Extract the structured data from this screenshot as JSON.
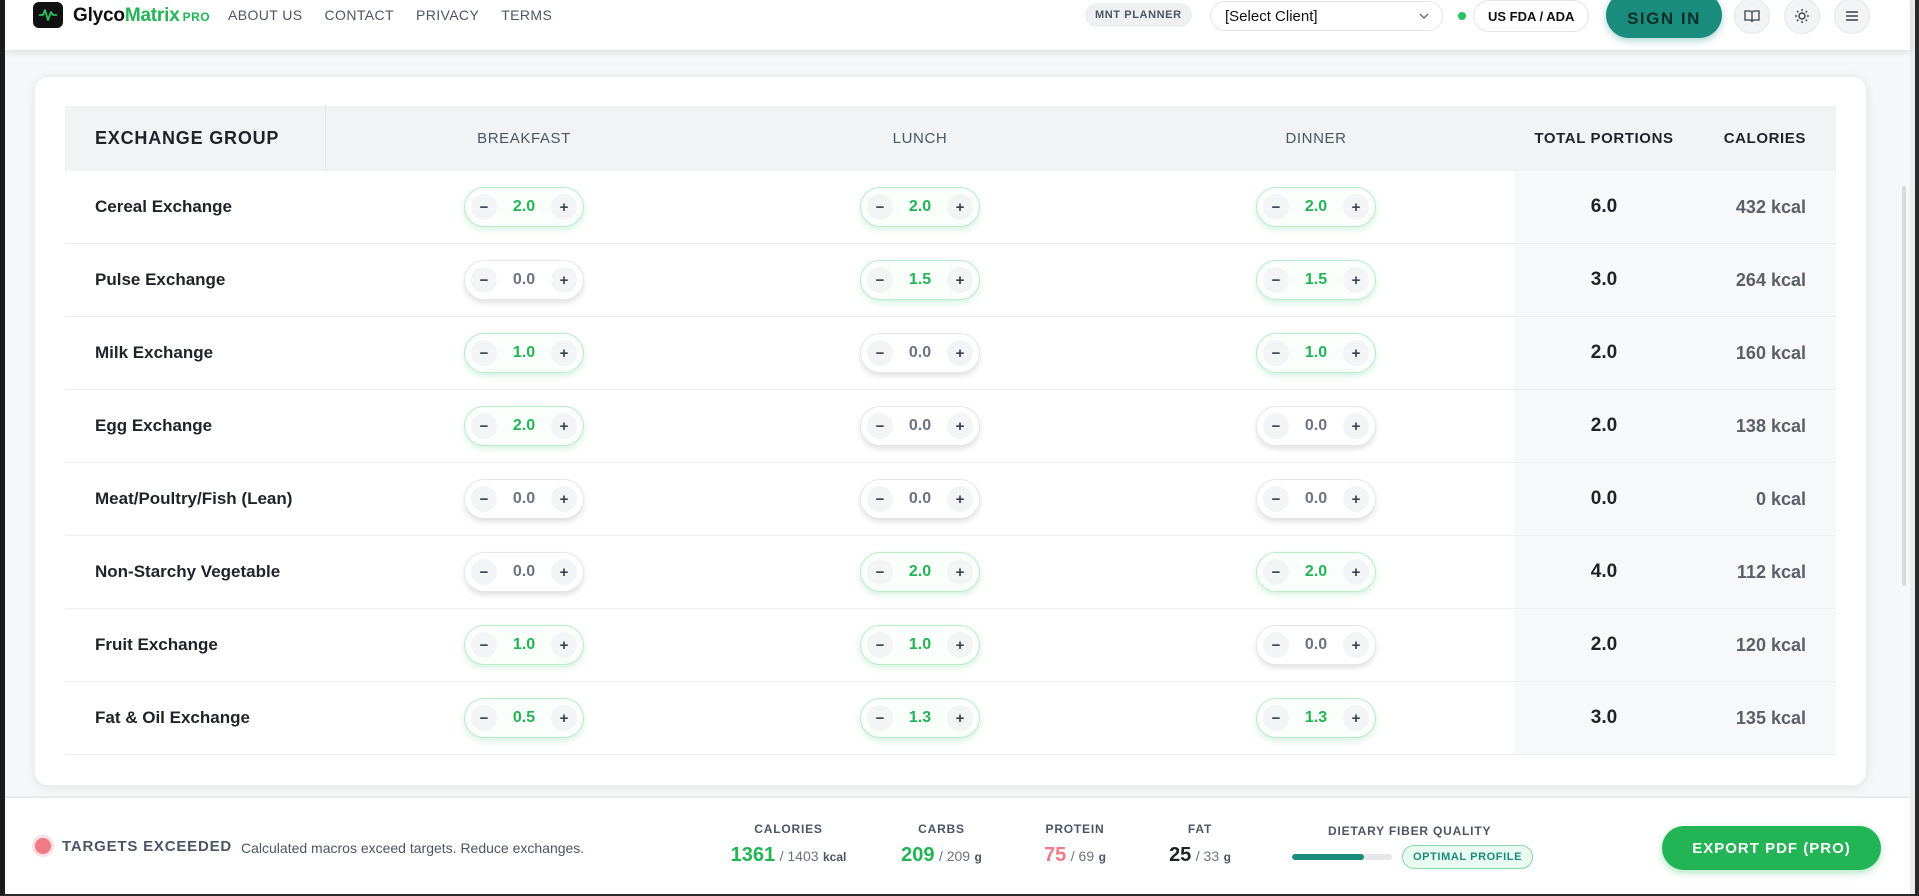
{
  "brand": {
    "name_part1": "Glyco",
    "name_part2": "Matrix",
    "tier": "PRO"
  },
  "nav": {
    "links": [
      "ABOUT US",
      "CONTACT",
      "PRIVACY",
      "TERMS"
    ]
  },
  "header": {
    "planner_label": "MNT PLANNER",
    "client_select_value": "[Select Client]",
    "regulation_label": "US FDA / ADA",
    "sign_in_label": "SIGN IN",
    "icons": [
      "book-icon",
      "sun-icon",
      "menu-icon"
    ]
  },
  "table": {
    "columns": {
      "group": "EXCHANGE GROUP",
      "breakfast": "BREAKFAST",
      "lunch": "LUNCH",
      "dinner": "DINNER",
      "total": "TOTAL PORTIONS",
      "calories": "CALORIES"
    },
    "rows": [
      {
        "name": "Cereal Exchange",
        "breakfast": "2.0",
        "lunch": "2.0",
        "dinner": "2.0",
        "total": "6.0",
        "calories": "432 kcal"
      },
      {
        "name": "Pulse Exchange",
        "breakfast": "0.0",
        "lunch": "1.5",
        "dinner": "1.5",
        "total": "3.0",
        "calories": "264 kcal"
      },
      {
        "name": "Milk Exchange",
        "breakfast": "1.0",
        "lunch": "0.0",
        "dinner": "1.0",
        "total": "2.0",
        "calories": "160 kcal"
      },
      {
        "name": "Egg Exchange",
        "breakfast": "2.0",
        "lunch": "0.0",
        "dinner": "0.0",
        "total": "2.0",
        "calories": "138 kcal"
      },
      {
        "name": "Meat/Poultry/Fish (Lean)",
        "breakfast": "0.0",
        "lunch": "0.0",
        "dinner": "0.0",
        "total": "0.0",
        "calories": "0 kcal"
      },
      {
        "name": "Non-Starchy Vegetable",
        "breakfast": "0.0",
        "lunch": "2.0",
        "dinner": "2.0",
        "total": "4.0",
        "calories": "112 kcal"
      },
      {
        "name": "Fruit Exchange",
        "breakfast": "1.0",
        "lunch": "1.0",
        "dinner": "0.0",
        "total": "2.0",
        "calories": "120 kcal"
      },
      {
        "name": "Fat & Oil Exchange",
        "breakfast": "0.5",
        "lunch": "1.3",
        "dinner": "1.3",
        "total": "3.0",
        "calories": "135 kcal"
      }
    ],
    "stepper_minus": "−",
    "stepper_plus": "+"
  },
  "footer": {
    "status_title": "TARGETS EXCEEDED",
    "status_message": "Calculated macros exceed targets. Reduce exchanges.",
    "status_color": "#f07a86",
    "macros": [
      {
        "label": "CALORIES",
        "value": "1361",
        "target": "/ 1403",
        "unit": "kcal",
        "color": "#22b455"
      },
      {
        "label": "CARBS",
        "value": "209",
        "target": "/ 209",
        "unit": "g",
        "color": "#22b455"
      },
      {
        "label": "PROTEIN",
        "value": "75",
        "target": "/ 69",
        "unit": "g",
        "color": "#f07a86"
      },
      {
        "label": "FAT",
        "value": "25",
        "target": "/ 33",
        "unit": "g",
        "color": "#1f2328"
      }
    ],
    "fiber": {
      "label": "DIETARY FIBER QUALITY",
      "level": 0.72,
      "badge": "OPTIMAL PROFILE"
    },
    "export_label": "EXPORT PDF (PRO)"
  },
  "colors": {
    "accent_green": "#22b455",
    "accent_teal": "#1a8c7e",
    "warning": "#f07a86"
  }
}
